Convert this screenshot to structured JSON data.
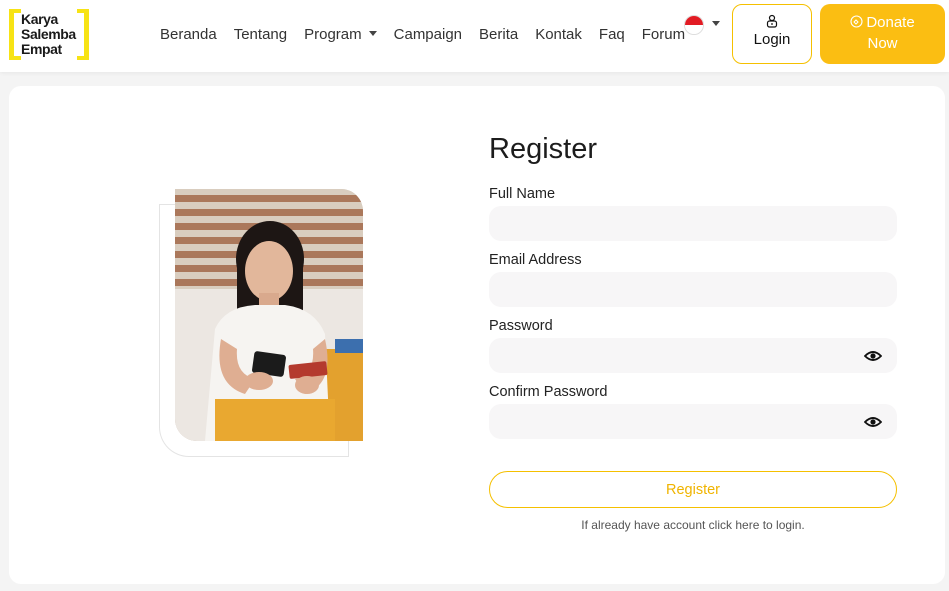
{
  "brand": {
    "logo_line1": "Karya",
    "logo_line2": "Salemba",
    "logo_line3": "Empat",
    "accent_yellow": "#fbbe12",
    "logo_yellow": "#f7e315"
  },
  "nav": {
    "items": [
      {
        "label": "Beranda"
      },
      {
        "label": "Tentang"
      },
      {
        "label": "Program",
        "dropdown": true
      },
      {
        "label": "Campaign"
      },
      {
        "label": "Berita"
      },
      {
        "label": "Kontak"
      },
      {
        "label": "Faq"
      },
      {
        "label": "Forum"
      }
    ],
    "language_flag": "indonesia-flag-icon",
    "login_label": "Login",
    "donate_line1": "Donate",
    "donate_line2": "Now"
  },
  "register": {
    "title": "Register",
    "fields": [
      {
        "label": "Full Name",
        "value": "",
        "type": "text"
      },
      {
        "label": "Email Address",
        "value": "",
        "type": "email"
      },
      {
        "label": "Password",
        "value": "",
        "type": "password"
      },
      {
        "label": "Confirm Password",
        "value": "",
        "type": "password"
      }
    ],
    "submit_label": "Register",
    "login_hint": "If already have account click here to login."
  },
  "illustration": {
    "icon": "woman-with-phone-and-card-photo"
  }
}
